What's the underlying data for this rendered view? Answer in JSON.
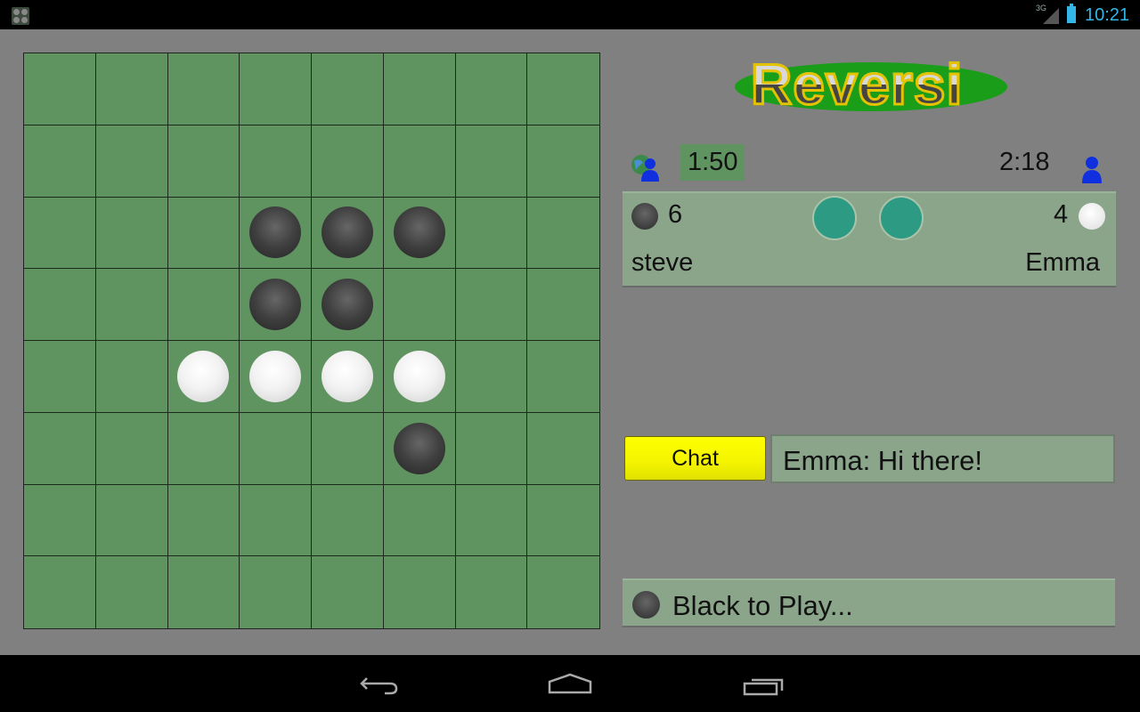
{
  "status_bar": {
    "app_icon": "reversi-app-icon",
    "network": "3G",
    "time": "10:21"
  },
  "board": {
    "size": 8,
    "pieces": [
      {
        "row": 2,
        "col": 3,
        "color": "black"
      },
      {
        "row": 2,
        "col": 4,
        "color": "black"
      },
      {
        "row": 2,
        "col": 5,
        "color": "black"
      },
      {
        "row": 3,
        "col": 3,
        "color": "black"
      },
      {
        "row": 3,
        "col": 4,
        "color": "black"
      },
      {
        "row": 4,
        "col": 2,
        "color": "white"
      },
      {
        "row": 4,
        "col": 3,
        "color": "white"
      },
      {
        "row": 4,
        "col": 4,
        "color": "white"
      },
      {
        "row": 4,
        "col": 5,
        "color": "white"
      },
      {
        "row": 5,
        "col": 5,
        "color": "black"
      }
    ]
  },
  "logo": {
    "text": "Reversi"
  },
  "timers": {
    "left": "1:50",
    "right": "2:18"
  },
  "players": {
    "left": {
      "name": "steve",
      "color": "black",
      "score": "6",
      "icon": "online-player-icon"
    },
    "right": {
      "name": "Emma",
      "color": "white",
      "score": "4",
      "icon": "person-icon"
    }
  },
  "chat": {
    "button_label": "Chat",
    "last_message": "Emma: Hi there!"
  },
  "status": {
    "text": "Black to Play..."
  },
  "colors": {
    "board_green": "#5f9360",
    "panel_green": "#8aa58a",
    "chat_yellow": "#ffff00",
    "indicator_teal": "#2d9a84",
    "clock_blue": "#33b5e5"
  },
  "nav_bar": {
    "buttons": [
      "back",
      "home",
      "recent-apps"
    ]
  }
}
